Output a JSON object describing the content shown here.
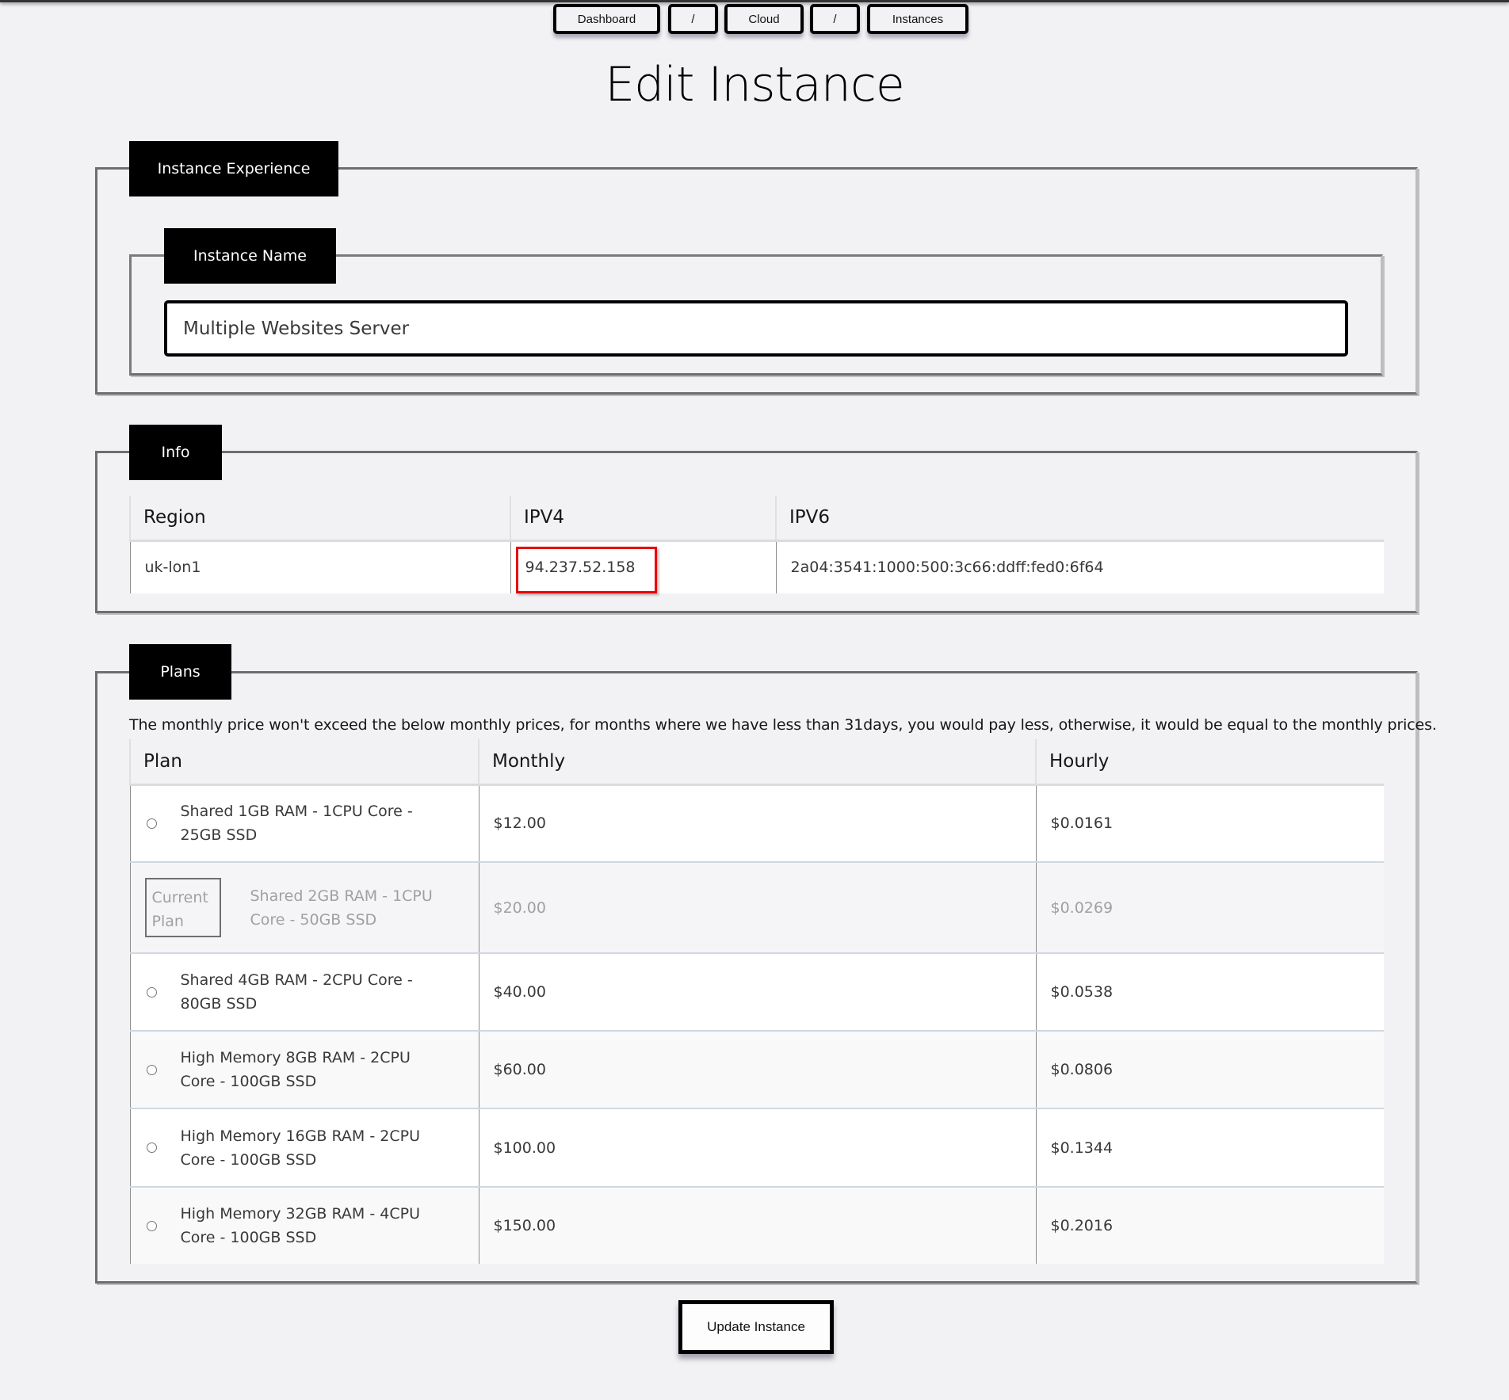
{
  "breadcrumb": {
    "items": [
      {
        "label": "Dashboard"
      },
      {
        "label": "/"
      },
      {
        "label": "Cloud"
      },
      {
        "label": "/"
      },
      {
        "label": "Instances"
      }
    ]
  },
  "page": {
    "title": "Edit Instance"
  },
  "instance_experience": {
    "legend": "Instance Experience",
    "name_section": {
      "legend": "Instance Name",
      "value": "Multiple Websites Server"
    }
  },
  "info": {
    "legend": "Info",
    "columns": [
      "Region",
      "IPV4",
      "IPV6"
    ],
    "row": {
      "region": "uk-lon1",
      "ipv4": "94.237.52.158",
      "ipv6": "2a04:3541:1000:500:3c66:ddff:fed0:6f64"
    },
    "highlight_color": "#e8000b"
  },
  "plans": {
    "legend": "Plans",
    "note": "The monthly price won't exceed the below monthly prices, for months where we have less than 31days, you would pay less, otherwise, it would be equal to the monthly prices.",
    "columns": [
      "Plan",
      "Monthly",
      "Hourly"
    ],
    "current_badge": "Current Plan",
    "rows": [
      {
        "plan": "Shared 1GB RAM - 1CPU Core - 25GB SSD",
        "monthly": "$12.00",
        "hourly": "$0.0161",
        "current": false
      },
      {
        "plan": "Shared 2GB RAM - 1CPU Core - 50GB SSD",
        "monthly": "$20.00",
        "hourly": "$0.0269",
        "current": true
      },
      {
        "plan": "Shared 4GB RAM - 2CPU Core - 80GB SSD",
        "monthly": "$40.00",
        "hourly": "$0.0538",
        "current": false
      },
      {
        "plan": "High Memory 8GB RAM - 2CPU Core - 100GB SSD",
        "monthly": "$60.00",
        "hourly": "$0.0806",
        "current": false
      },
      {
        "plan": "High Memory 16GB RAM - 2CPU Core - 100GB SSD",
        "monthly": "$100.00",
        "hourly": "$0.1344",
        "current": false
      },
      {
        "plan": "High Memory 32GB RAM - 4CPU Core - 100GB SSD",
        "monthly": "$150.00",
        "hourly": "$0.2016",
        "current": false
      }
    ]
  },
  "actions": {
    "update_label": "Update Instance"
  }
}
